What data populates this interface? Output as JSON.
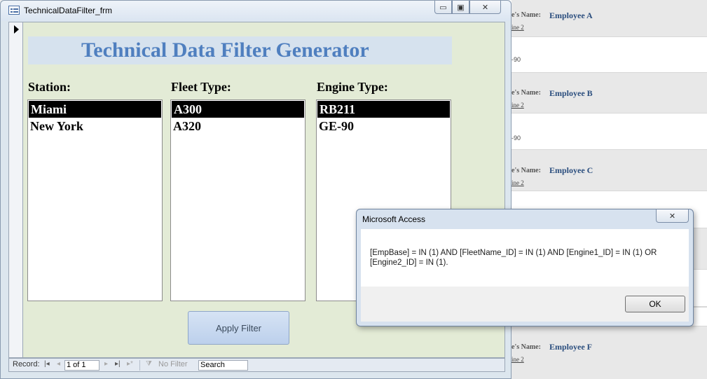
{
  "report": {
    "label": "e's Name:",
    "engine_link": "ine 2",
    "engine_value": "-90",
    "employees": [
      "Employee A",
      "Employee B",
      "Employee C",
      "Employee F"
    ]
  },
  "form": {
    "window_title": "TechnicalDataFilter_frm",
    "window_buttons": {
      "minimize": "▭",
      "maximize": "▣",
      "close": "✕"
    },
    "header_title": "Technical Data Filter Generator",
    "station": {
      "label": "Station:",
      "items": [
        "Miami",
        "New York"
      ],
      "selected": "Miami"
    },
    "fleet": {
      "label": "Fleet Type:",
      "items": [
        "A300",
        "A320"
      ],
      "selected": "A300"
    },
    "engine": {
      "label": "Engine Type:",
      "items": [
        "RB211",
        "GE-90"
      ],
      "selected": "RB211"
    },
    "apply_button": "Apply Filter"
  },
  "nav": {
    "record_label": "Record:",
    "first": "|◂",
    "prev": "◂",
    "record_value": "1 of 1",
    "next": "▸",
    "last": "▸|",
    "new": "▸*",
    "no_filter": "No Filter",
    "search": "Search"
  },
  "dialog": {
    "title": "Microsoft Access",
    "close": "✕",
    "message": "[EmpBase] = IN (1) AND [FleetName_ID] = IN (1) AND [Engine1_ID] = IN (1) OR [Engine2_ID] = IN (1).",
    "ok": "OK"
  }
}
